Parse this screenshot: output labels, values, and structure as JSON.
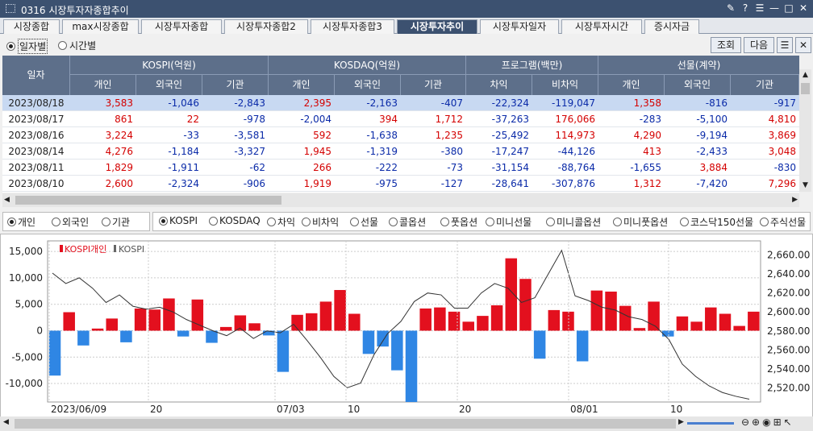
{
  "window": {
    "title": "0316 시장투자자종합추이"
  },
  "tabs": [
    "시장종합",
    "max시장종합",
    "시장투자종합",
    "시장투자종합2",
    "시장투자종합3",
    "시장투자추이",
    "시장투자일자",
    "시장투자시간",
    "증시자금"
  ],
  "options": {
    "daily": "일자별",
    "hourly": "시간별"
  },
  "buttons": {
    "query": "조회",
    "next": "다음"
  },
  "grid": {
    "date_header": "일자",
    "groups": [
      "KOSPI(억원)",
      "KOSDAQ(억원)",
      "프로그램(백만)",
      "선물(계약)"
    ],
    "subheaders": [
      "개인",
      "외국인",
      "기관",
      "개인",
      "외국인",
      "기관",
      "차익",
      "비차익",
      "개인",
      "외국인",
      "기관"
    ],
    "rows": [
      [
        "2023/08/18",
        "3,583",
        "-1,046",
        "-2,843",
        "2,395",
        "-2,163",
        "-407",
        "-22,324",
        "-119,047",
        "1,358",
        "-816",
        "-917"
      ],
      [
        "2023/08/17",
        "861",
        "22",
        "-978",
        "-2,004",
        "394",
        "1,712",
        "-37,263",
        "176,066",
        "-283",
        "-5,100",
        "4,810"
      ],
      [
        "2023/08/16",
        "3,224",
        "-33",
        "-3,581",
        "592",
        "-1,638",
        "1,235",
        "-25,492",
        "114,973",
        "4,290",
        "-9,194",
        "3,869"
      ],
      [
        "2023/08/14",
        "4,276",
        "-1,184",
        "-3,327",
        "1,945",
        "-1,319",
        "-380",
        "-17,247",
        "-44,126",
        "413",
        "-2,433",
        "3,048"
      ],
      [
        "2023/08/11",
        "1,829",
        "-1,911",
        "-62",
        "266",
        "-222",
        "-73",
        "-31,154",
        "-88,764",
        "-1,655",
        "3,884",
        "-830"
      ],
      [
        "2023/08/10",
        "2,600",
        "-2,324",
        "-906",
        "1,919",
        "-975",
        "-127",
        "-28,641",
        "-307,876",
        "1,312",
        "-7,420",
        "7,296"
      ]
    ]
  },
  "investor_opts": [
    "개인",
    "외국인",
    "기관"
  ],
  "market_opts": [
    "KOSPI",
    "KOSDAQ",
    "차익",
    "비차익",
    "선물",
    "콜옵션",
    "풋옵션",
    "미니선물",
    "미니콜옵션",
    "미니풋옵션",
    "코스닥150선물",
    "주식선물"
  ],
  "chart_data": {
    "type": "bar",
    "legend": [
      "KOSPI개인",
      "KOSPI"
    ],
    "x_labels": [
      "2023/06/09",
      "20",
      "07/03",
      "10",
      "20",
      "08/01",
      "10"
    ],
    "left_ticks": [
      "15,000",
      "10,000",
      "5,000",
      "0",
      "-5,000",
      "-10,000"
    ],
    "right_ticks": [
      "2,660.00",
      "2,640.00",
      "2,620.00",
      "2,600.00",
      "2,580.00",
      "2,560.00",
      "2,540.00",
      "2,520.00"
    ],
    "ylim_left": [
      -13500,
      17000
    ],
    "ylim_right": [
      2505,
      2675
    ],
    "bars": [
      -8500,
      3500,
      -2800,
      400,
      2300,
      -2200,
      4200,
      4000,
      6100,
      -1100,
      5900,
      -2300,
      700,
      2900,
      1400,
      -900,
      -7800,
      3000,
      3300,
      5500,
      7700,
      3200,
      -4400,
      -3000,
      -7500,
      -13500,
      4200,
      4400,
      3600,
      1700,
      2800,
      4800,
      13700,
      9800,
      -5300,
      3900,
      3600,
      -5800,
      7600,
      7400,
      4700,
      500,
      5500,
      -1100,
      2700,
      1700,
      4400,
      3200,
      900,
      3600
    ],
    "kospi": [
      2641,
      2630,
      2636,
      2625,
      2610,
      2618,
      2606,
      2603,
      2605,
      2600,
      2592,
      2586,
      2580,
      2575,
      2583,
      2572,
      2580,
      2578,
      2587,
      2570,
      2552,
      2532,
      2520,
      2525,
      2555,
      2577,
      2590,
      2611,
      2620,
      2618,
      2604,
      2604,
      2620,
      2630,
      2625,
      2610,
      2615,
      2640,
      2665,
      2617,
      2612,
      2605,
      2602,
      2595,
      2592,
      2585,
      2571,
      2545,
      2532,
      2522,
      2515,
      2511,
      2508
    ]
  }
}
